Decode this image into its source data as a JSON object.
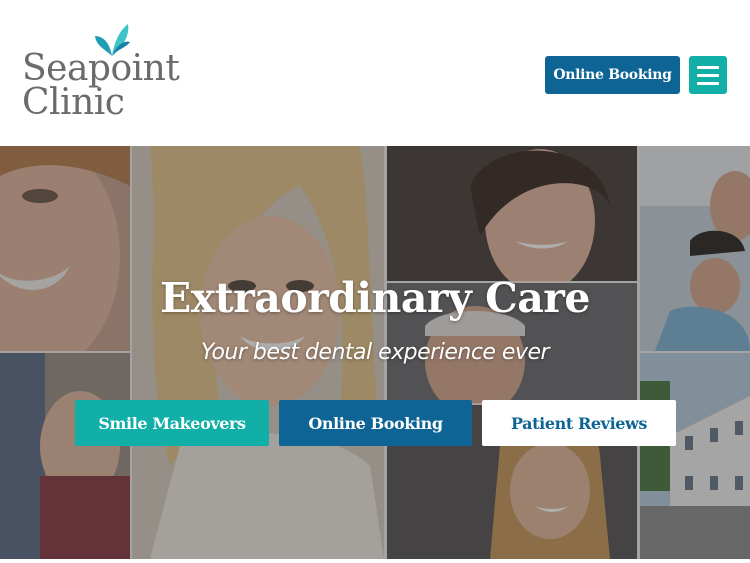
{
  "header": {
    "logo_line1": "Seapoint",
    "logo_line2": "Clinic",
    "booking_label": "Online Booking",
    "menu_icon": "hamburger-icon"
  },
  "hero": {
    "title": "Extraordinary Care",
    "subtitle": "Your best dental experience ever",
    "buttons": [
      {
        "label": "Smile Makeovers"
      },
      {
        "label": "Online Booking"
      },
      {
        "label": "Patient Reviews"
      }
    ]
  },
  "colors": {
    "teal": "#12aea8",
    "blue": "#0e6494",
    "logo_gray": "#6b6b6b"
  }
}
